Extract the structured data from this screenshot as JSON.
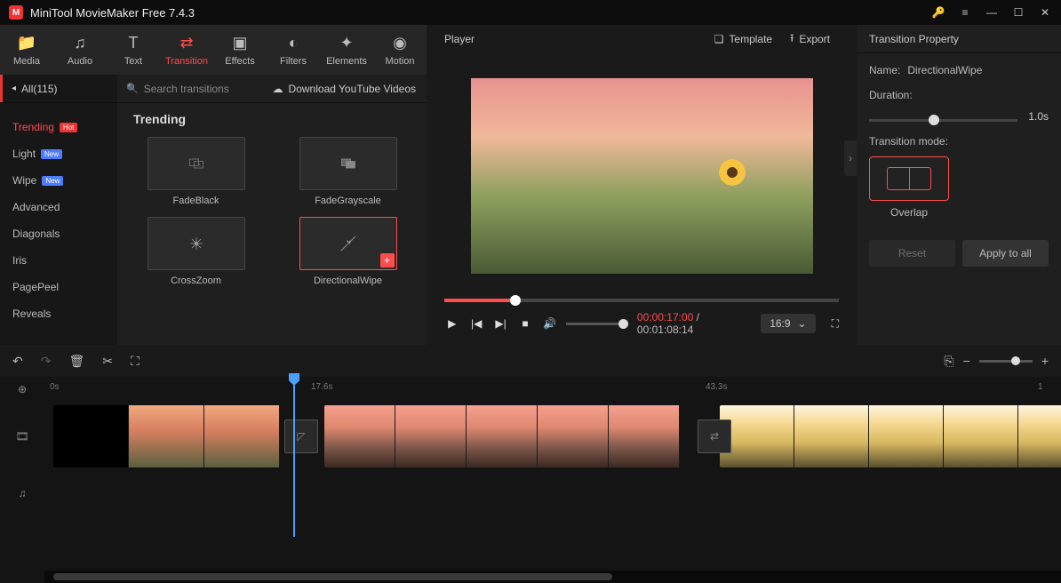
{
  "titlebar": {
    "title": "MiniTool MovieMaker Free 7.4.3"
  },
  "toolbar": {
    "media": "Media",
    "audio": "Audio",
    "text": "Text",
    "transition": "Transition",
    "effects": "Effects",
    "filters": "Filters",
    "elements": "Elements",
    "motion": "Motion"
  },
  "search": {
    "all_label": "All(115)",
    "placeholder": "Search transitions",
    "download_label": "Download YouTube Videos"
  },
  "sidebar": {
    "items": [
      {
        "label": "Trending",
        "badge": "Hot"
      },
      {
        "label": "Light",
        "badge": "New"
      },
      {
        "label": "Wipe",
        "badge": "New"
      },
      {
        "label": "Advanced"
      },
      {
        "label": "Diagonals"
      },
      {
        "label": "Iris"
      },
      {
        "label": "PagePeel"
      },
      {
        "label": "Reveals"
      }
    ]
  },
  "grid": {
    "heading": "Trending",
    "items": [
      {
        "name": "FadeBlack"
      },
      {
        "name": "FadeGrayscale"
      },
      {
        "name": "CrossZoom"
      },
      {
        "name": "DirectionalWipe",
        "selected": true
      }
    ]
  },
  "player": {
    "title": "Player",
    "template": "Template",
    "export": "Export",
    "time_current": "00:00:17:00",
    "time_total": "00:01:08:14",
    "time_sep": " / ",
    "aspect": "16:9"
  },
  "props": {
    "title": "Transition Property",
    "name_label": "Name:",
    "name_value": "DirectionalWipe",
    "duration_label": "Duration:",
    "duration_value": "1.0s",
    "mode_label": "Transition mode:",
    "mode_overlap": "Overlap",
    "reset": "Reset",
    "apply_all": "Apply to all"
  },
  "ruler": {
    "t0": "0s",
    "t1": "17.6s",
    "t2": "43.3s",
    "t3": "1"
  }
}
